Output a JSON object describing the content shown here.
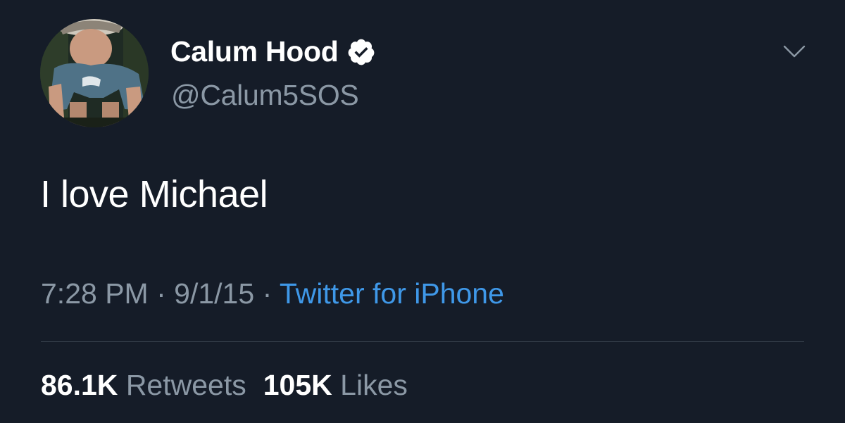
{
  "user": {
    "display_name": "Calum Hood",
    "handle": "@Calum5SOS",
    "verified": true,
    "avatar_icon": "profile-photo"
  },
  "tweet": {
    "text": "I love Michael",
    "time": "7:28 PM",
    "date": "9/1/15",
    "source": "Twitter for iPhone",
    "separator": "·"
  },
  "stats": {
    "retweets_count": "86.1K",
    "retweets_label": "Retweets",
    "likes_count": "105K",
    "likes_label": "Likes"
  },
  "colors": {
    "background": "#151c28",
    "text_primary": "#ffffff",
    "text_secondary": "#8b98a5",
    "link": "#3f98e8",
    "divider": "#38424e"
  }
}
